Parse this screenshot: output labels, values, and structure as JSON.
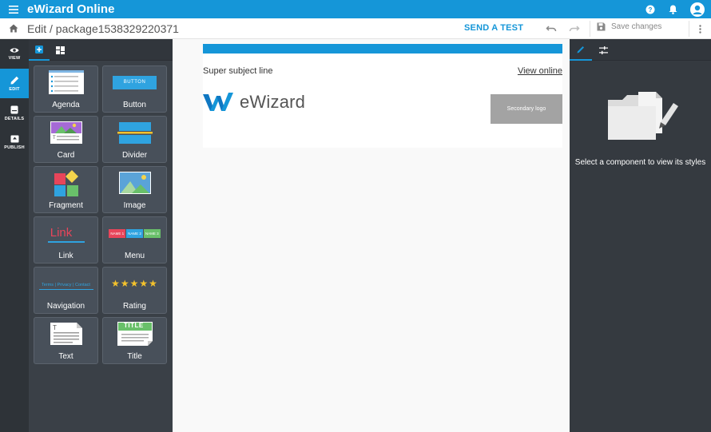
{
  "app": {
    "title": "eWizard Online"
  },
  "header": {
    "breadcrumb": "Edit / package1538329220371",
    "send_test": "SEND A TEST",
    "save_changes": "Save changes"
  },
  "rail": {
    "items": [
      {
        "label": "VIEW",
        "icon": "eye-icon"
      },
      {
        "label": "EDIT",
        "icon": "pencil-icon"
      },
      {
        "label": "DETAILS",
        "icon": "details-icon"
      },
      {
        "label": "PUBLISH",
        "icon": "publish-icon"
      }
    ]
  },
  "components": [
    {
      "label": "Agenda"
    },
    {
      "label": "Button",
      "thumb_text": "BUTTON"
    },
    {
      "label": "Card"
    },
    {
      "label": "Divider"
    },
    {
      "label": "Fragment"
    },
    {
      "label": "Image"
    },
    {
      "label": "Link",
      "thumb_text": "Link"
    },
    {
      "label": "Menu",
      "thumb_items": [
        "NAME 1",
        "NAME 2",
        "NAME 3"
      ]
    },
    {
      "label": "Navigation",
      "thumb_text": "Terms | Privacy | Contact"
    },
    {
      "label": "Rating"
    },
    {
      "label": "Text"
    },
    {
      "label": "Title",
      "thumb_text": "TITLE"
    }
  ],
  "email": {
    "subject": "Super subject line",
    "view_online": "View online",
    "logo_text": "eWizard",
    "secondary_logo": "Secondary logo"
  },
  "styles_panel": {
    "hint": "Select a component to view its styles"
  },
  "colors": {
    "accent": "#1596d8",
    "dark_panel": "#3a4047",
    "rail": "#2e3338"
  }
}
